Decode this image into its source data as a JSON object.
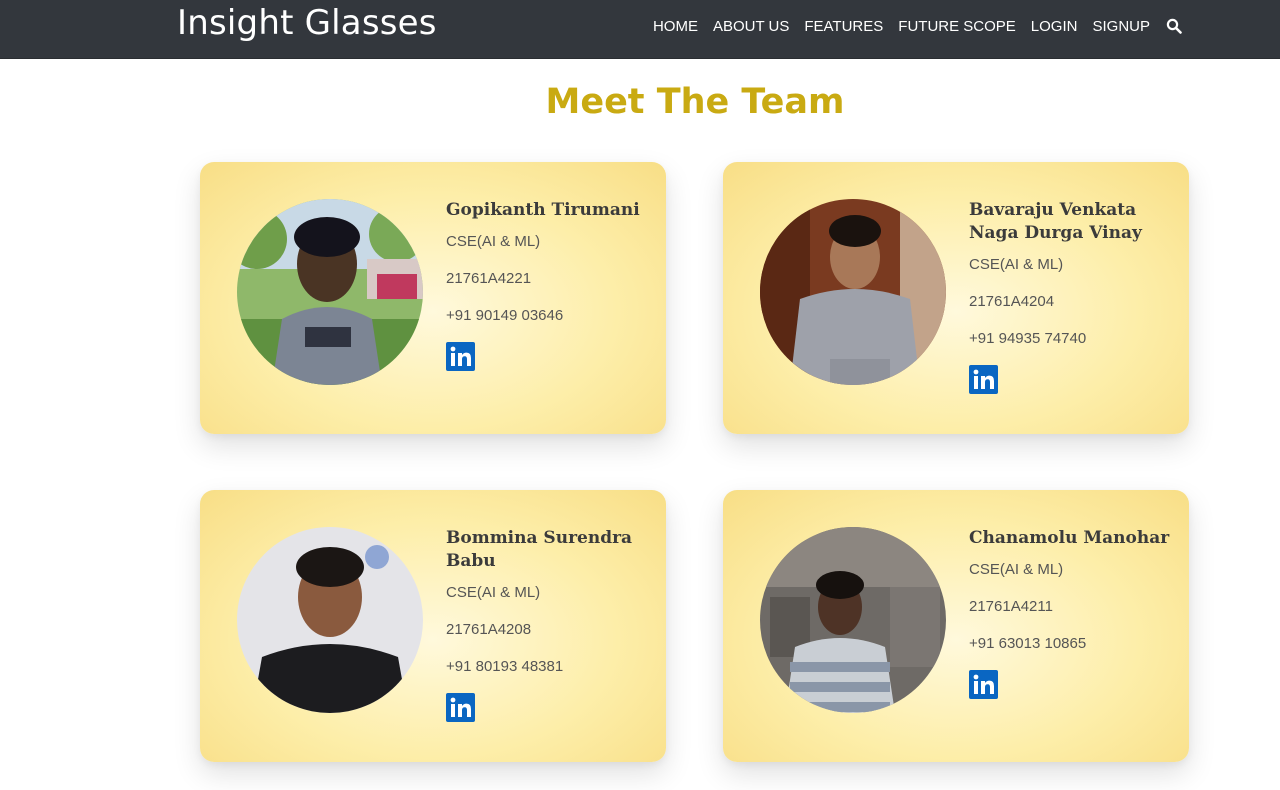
{
  "nav": {
    "brand": "Insight Glasses",
    "links": [
      "HOME",
      "ABOUT US",
      "FEATURES",
      "FUTURE SCOPE",
      "LOGIN",
      "SIGNUP"
    ]
  },
  "heading": "Meet The Team",
  "team": [
    {
      "name": "Gopikanth Tirumani",
      "branch": "CSE(AI & ML)",
      "roll": "21761A4221",
      "phone": "+91 90149 03646"
    },
    {
      "name": "Bavaraju Venkata Naga Durga Vinay",
      "branch": "CSE(AI & ML)",
      "roll": "21761A4204",
      "phone": "+91 94935 74740"
    },
    {
      "name": "Bommina Surendra Babu",
      "branch": "CSE(AI & ML)",
      "roll": "21761A4208",
      "phone": "+91 80193 48381"
    },
    {
      "name": "Chanamolu Manohar",
      "branch": "CSE(AI & ML)",
      "roll": "21761A4211",
      "phone": "+91 63013 10865"
    }
  ],
  "colors": {
    "navbar": "#33373d",
    "heading": "#c9aa12",
    "card": "#fdeea9",
    "linkedin": "#0a66c2"
  }
}
